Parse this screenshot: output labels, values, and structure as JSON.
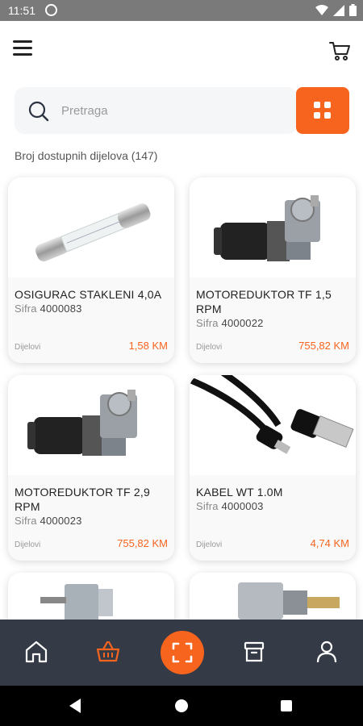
{
  "status_bar": {
    "time": "11:51"
  },
  "search": {
    "placeholder": "Pretraga"
  },
  "count_text": "Broj dostupnih dijelova (147)",
  "code_label": "Sifra",
  "products": [
    {
      "name": "OSIGURAC STAKLENI 4,0A",
      "code": "4000083",
      "category": "Dijelovi",
      "price": "1,58 KM",
      "image": "glass-fuse"
    },
    {
      "name": "MOTOREDUKTOR TF 1,5 RPM",
      "code": "4000022",
      "category": "Dijelovi",
      "price": "755,82 KM",
      "image": "gear-motor"
    },
    {
      "name": "MOTOREDUKTOR TF 2,9 RPM",
      "code": "4000023",
      "category": "Dijelovi",
      "price": "755,82 KM",
      "image": "gear-motor"
    },
    {
      "name": "KABEL WT 1.0M",
      "code": "4000003",
      "category": "Dijelovi",
      "price": "4,74 KM",
      "image": "usb-cable"
    },
    {
      "name": "",
      "code": "",
      "category": "",
      "price": "",
      "image": "shaft-motor"
    },
    {
      "name": "",
      "code": "",
      "category": "",
      "price": "",
      "image": "actuator"
    }
  ],
  "bottom_nav": [
    "home-icon",
    "basket-icon",
    "scan-icon",
    "box-icon",
    "profile-icon"
  ],
  "colors": {
    "accent": "#f7641e",
    "nav_bg": "#343a46",
    "status_bg": "#7a7a7a"
  }
}
